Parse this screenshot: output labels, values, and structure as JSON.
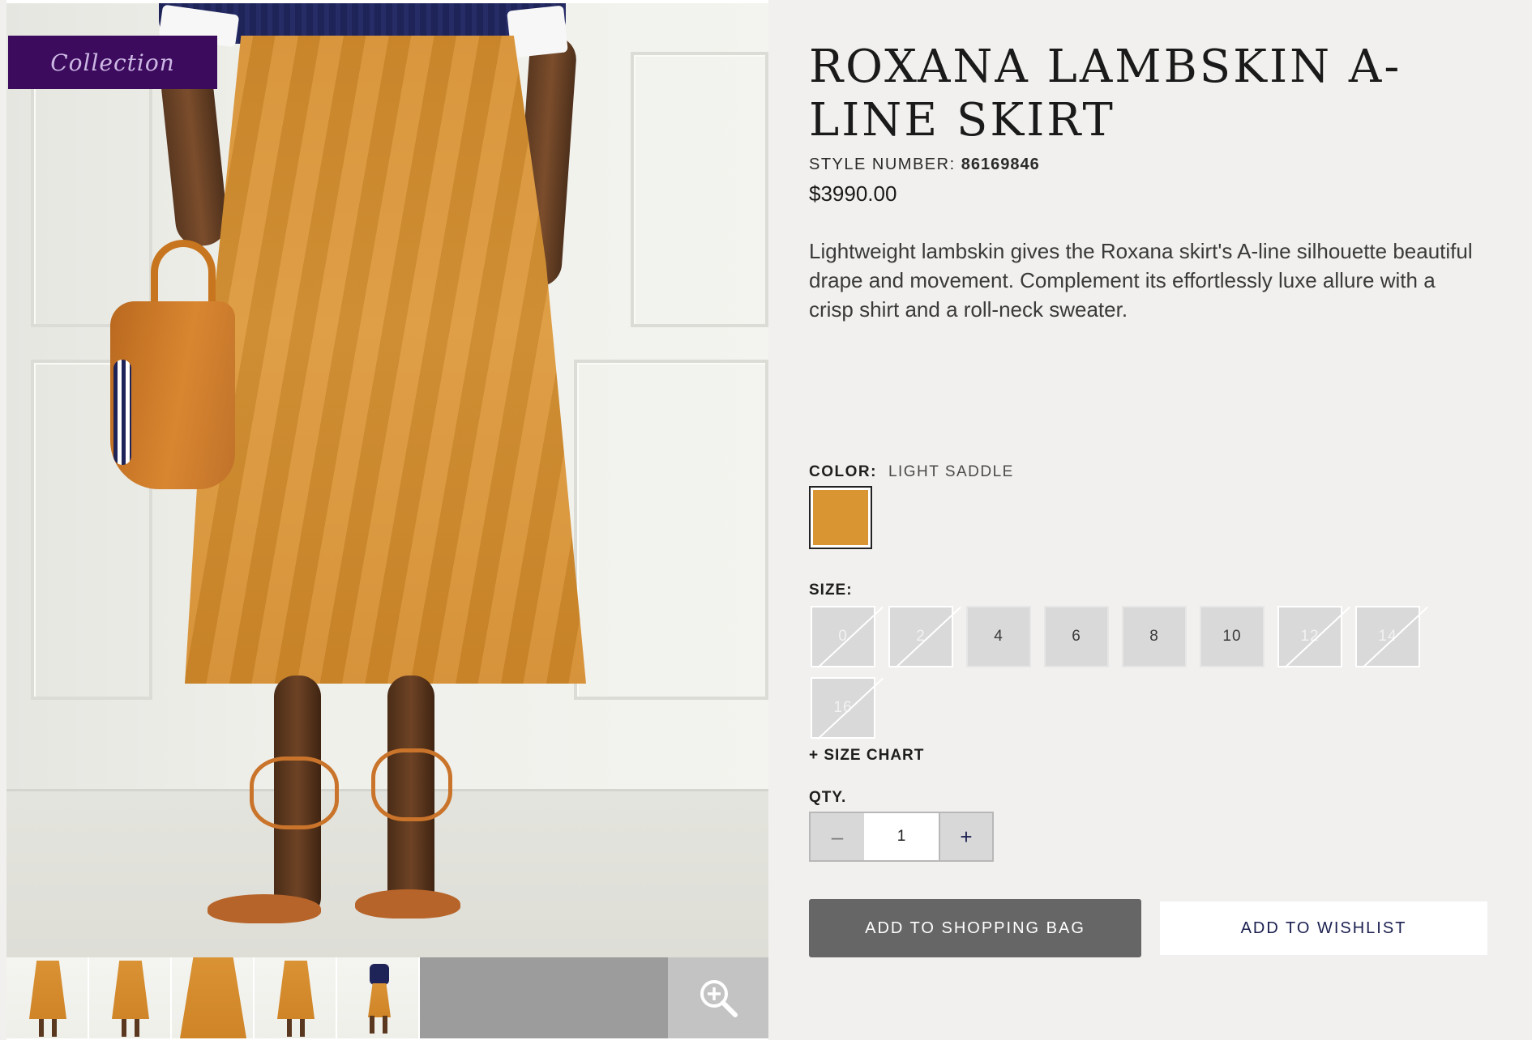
{
  "badge": {
    "label": "Collection"
  },
  "product": {
    "title": "ROXANA LAMBSKIN A-LINE SKIRT",
    "style_label": "STYLE NUMBER:",
    "style_number": "86169846",
    "price": "$3990.00",
    "description": "Lightweight lambskin gives the Roxana skirt's A-line silhouette beautiful drape and movement. Complement its effortlessly luxe allure with a crisp shirt and a roll-neck sweater."
  },
  "color": {
    "label": "COLOR:",
    "value": "LIGHT SADDLE",
    "swatch_hex": "#d89531"
  },
  "size": {
    "label": "SIZE:",
    "options": [
      {
        "label": "0",
        "available": false
      },
      {
        "label": "2",
        "available": false
      },
      {
        "label": "4",
        "available": true
      },
      {
        "label": "6",
        "available": true
      },
      {
        "label": "8",
        "available": true
      },
      {
        "label": "10",
        "available": true
      },
      {
        "label": "12",
        "available": false
      },
      {
        "label": "14",
        "available": false
      },
      {
        "label": "16",
        "available": false
      }
    ],
    "chart_link": "+ SIZE CHART"
  },
  "quantity": {
    "label": "QTY.",
    "value": "1",
    "minus": "–",
    "plus": "+"
  },
  "actions": {
    "add_to_bag": "ADD TO SHOPPING BAG",
    "add_to_wishlist": "ADD TO WISHLIST"
  },
  "gallery": {
    "thumbnail_count": 5,
    "zoom_icon": "zoom-in-icon"
  },
  "colors": {
    "accent_purple": "#3c0b5e",
    "navy": "#1b1f4f",
    "bag_button": "#666666"
  }
}
